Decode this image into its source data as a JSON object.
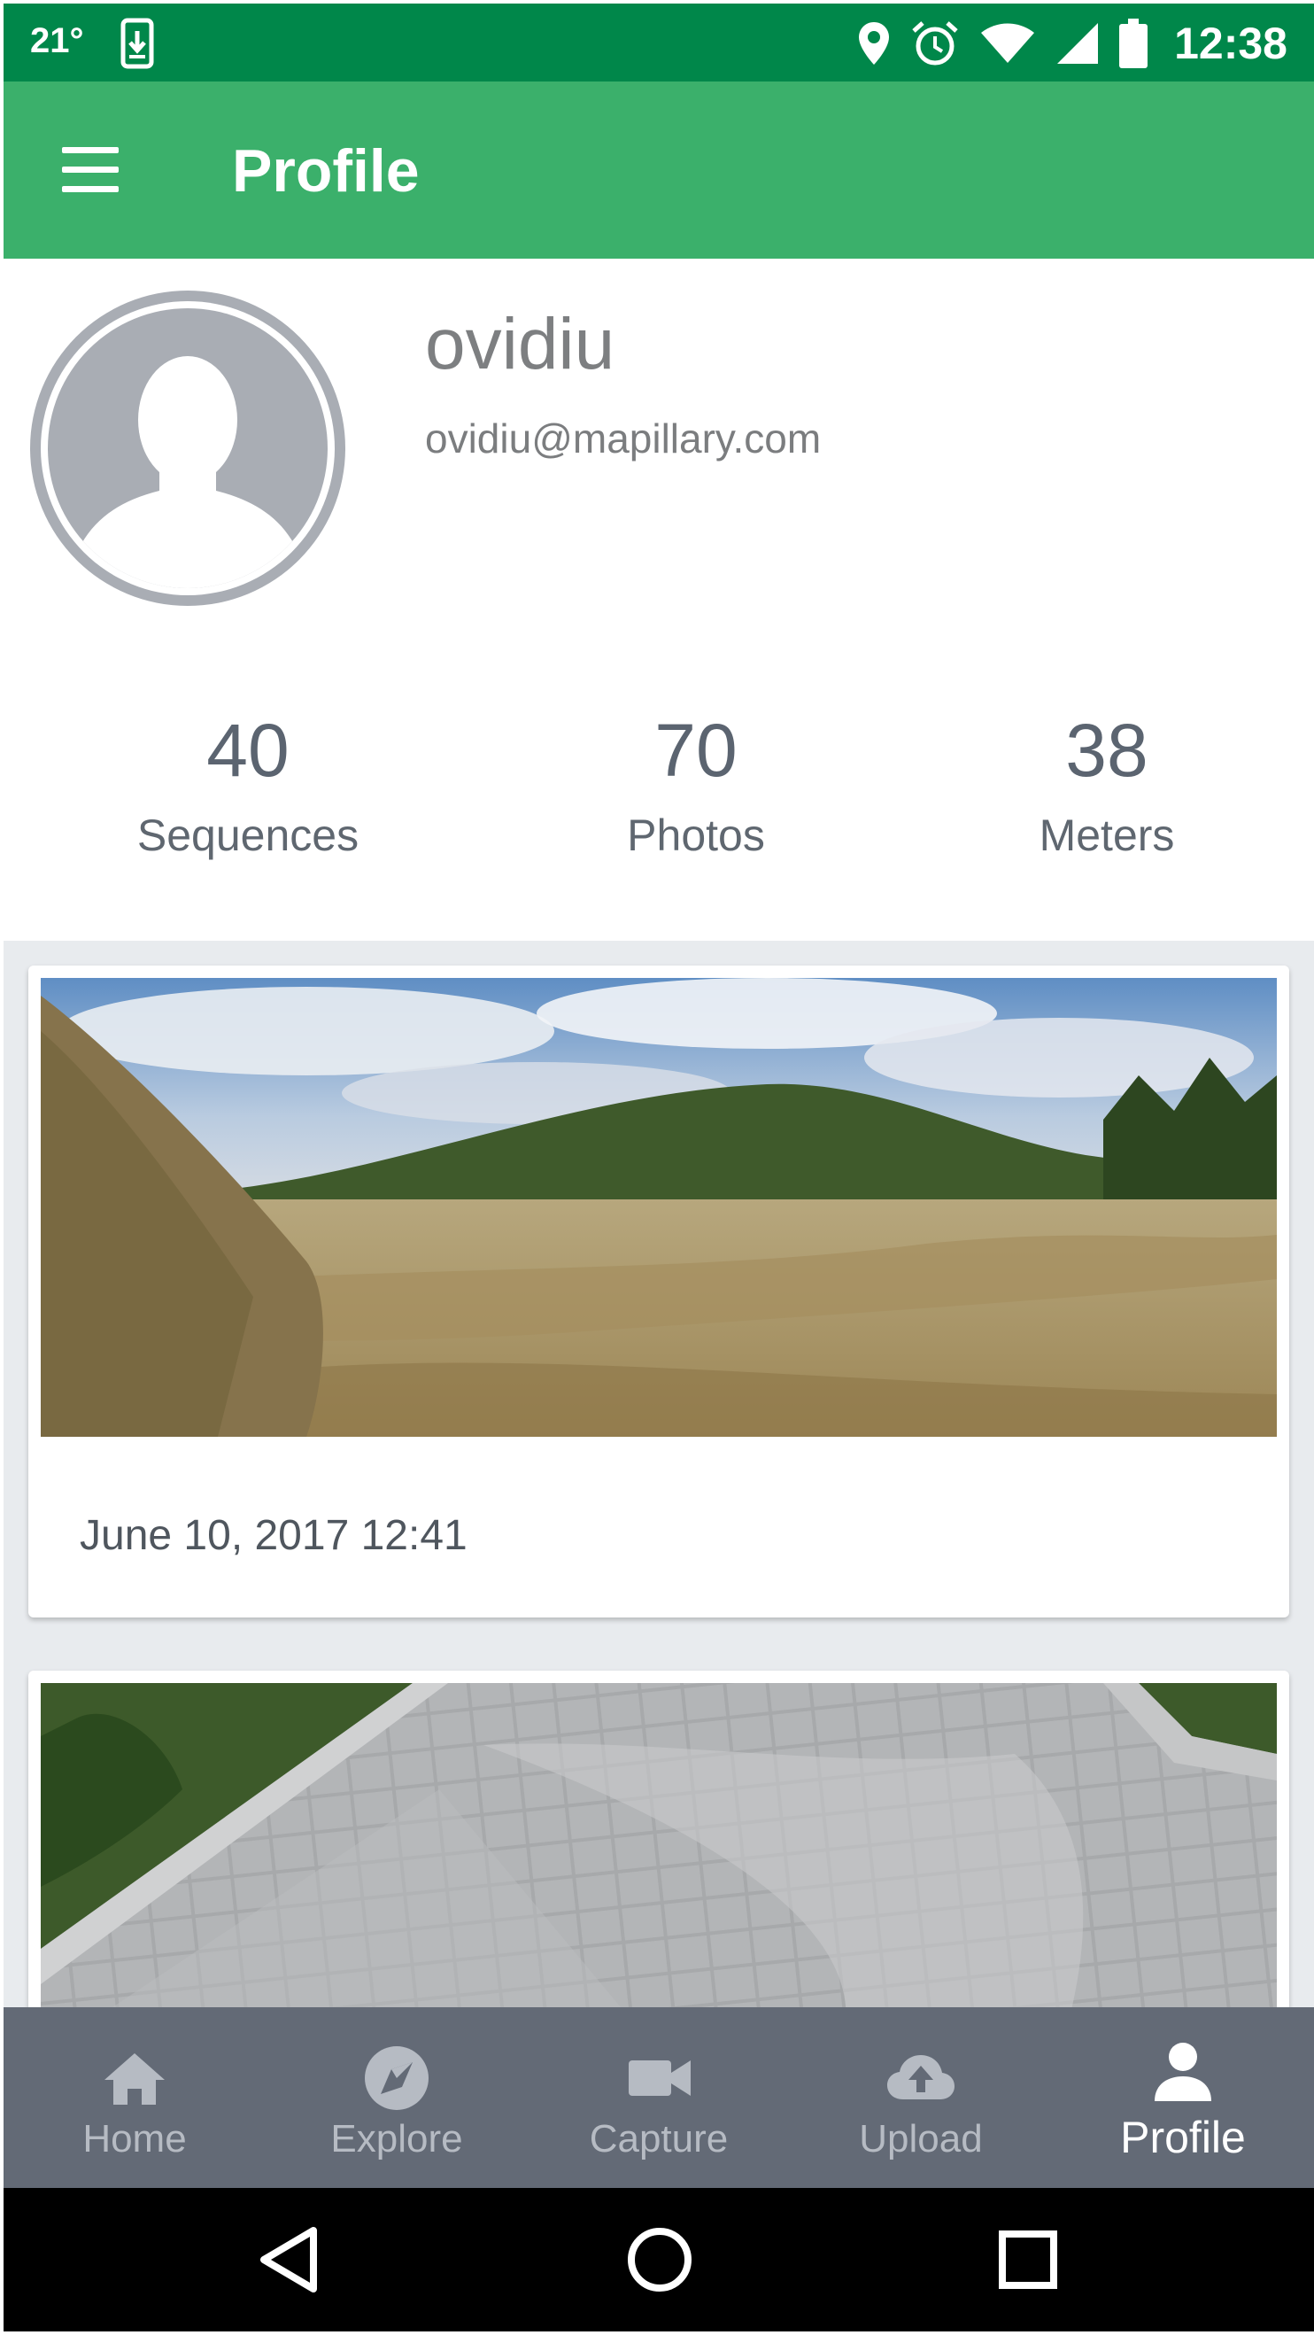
{
  "status_bar": {
    "temperature": "21°",
    "time": "12:38",
    "icons": [
      "download-notification-icon",
      "location-icon",
      "alarm-icon",
      "wifi-icon",
      "signal-icon",
      "battery-icon"
    ]
  },
  "app_bar": {
    "title": "Profile",
    "menu_icon": "hamburger-menu-icon"
  },
  "profile": {
    "username": "ovidiu",
    "email": "ovidiu@mapillary.com",
    "avatar_icon": "default-avatar-icon",
    "stats": [
      {
        "value": "40",
        "label": "Sequences"
      },
      {
        "value": "70",
        "label": "Photos"
      },
      {
        "value": "38",
        "label": "Meters"
      }
    ]
  },
  "feed": {
    "cards": [
      {
        "date": "June 10, 2017 12:41",
        "image": "landscape-hills-photo"
      },
      {
        "date": "",
        "image": "paved-walkway-photo"
      }
    ]
  },
  "bottom_nav": {
    "items": [
      {
        "label": "Home",
        "icon": "home-icon",
        "active": false
      },
      {
        "label": "Explore",
        "icon": "compass-icon",
        "active": false
      },
      {
        "label": "Capture",
        "icon": "video-camera-icon",
        "active": false
      },
      {
        "label": "Upload",
        "icon": "cloud-upload-icon",
        "active": false
      },
      {
        "label": "Profile",
        "icon": "person-icon",
        "active": true
      }
    ]
  },
  "colors": {
    "status_bar": "#00874a",
    "app_bar": "#3bb06b",
    "bottom_nav": "#636a76",
    "feed_background": "#e8ebee"
  }
}
